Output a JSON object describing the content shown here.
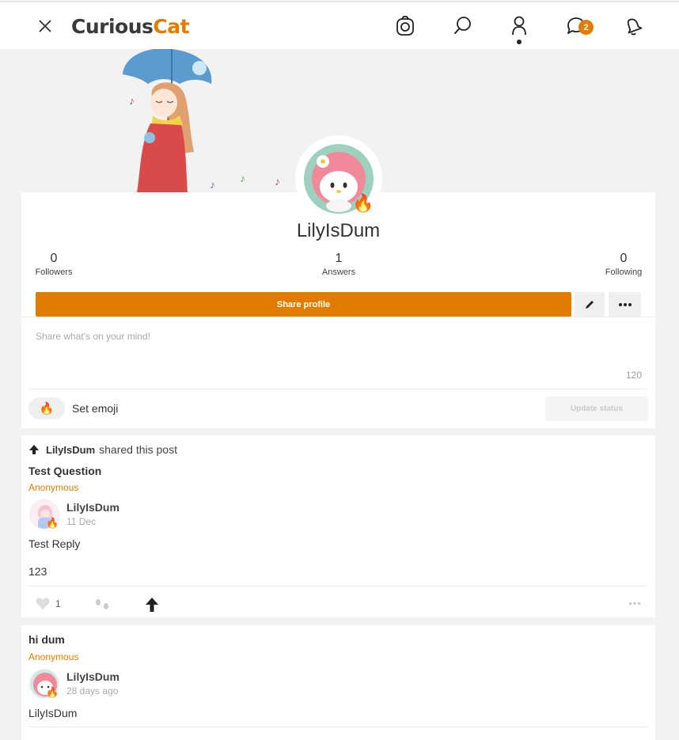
{
  "header": {
    "logo_part1": "Curious",
    "logo_part2": "Cat",
    "messages_badge": "2"
  },
  "profile": {
    "username": "LilyIsDum",
    "avatar_emoji": "🔥",
    "stats": [
      {
        "value": "0",
        "label": "Followers"
      },
      {
        "value": "1",
        "label": "Answers"
      },
      {
        "value": "0",
        "label": "Following"
      }
    ],
    "share_label": "Share profile",
    "status_placeholder": "Share what's on your mind!",
    "char_count": "120",
    "emoji": "🔥",
    "set_emoji_label": "Set emoji",
    "update_label": "Update status"
  },
  "posts": [
    {
      "shared_by": "LilyIsDum",
      "shared_text": "shared this post",
      "question": "Test Question",
      "asker": "Anonymous",
      "answerer": "LilyIsDum",
      "answer_emoji": "🔥",
      "date": "11 Dec",
      "answer_lines": [
        "Test Reply",
        "123"
      ],
      "likes": "1"
    },
    {
      "question": "hi dum",
      "asker": "Anonymous",
      "answerer": "LilyIsDum",
      "answer_emoji": "🔥",
      "date": "28 days ago",
      "answer_lines": [
        "LilyIsDum"
      ]
    }
  ],
  "colors": {
    "accent": "#e07c00",
    "background": "#f2f2f2"
  }
}
